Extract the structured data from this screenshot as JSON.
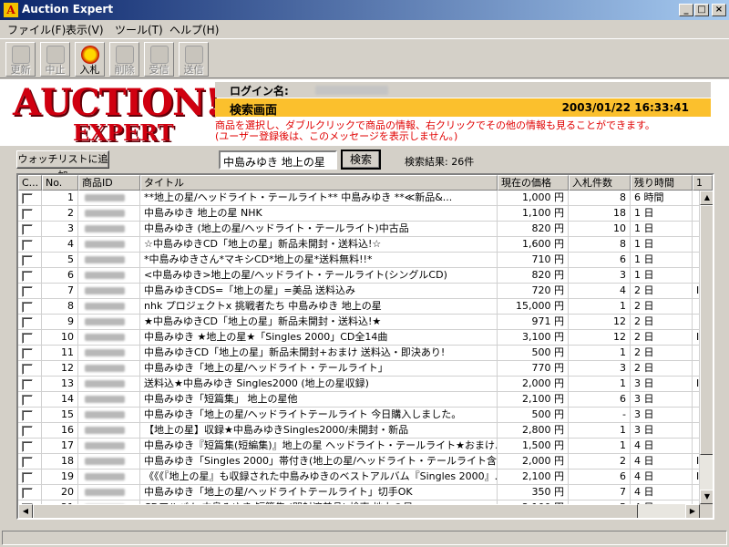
{
  "window": {
    "title": "Auction Expert",
    "app_icon_letter": "A",
    "minimize_glyph": "_",
    "maximize_glyph": "□",
    "close_glyph": "×"
  },
  "menu": [
    {
      "label": "ファイル(F)"
    },
    {
      "label": "表示(V)"
    },
    {
      "label": "ツール(T)"
    },
    {
      "label": "ヘルプ(H)"
    }
  ],
  "toolbar": [
    {
      "label": "更新",
      "icon": "refresh-icon",
      "state": "disabled"
    },
    {
      "label": "中止",
      "icon": "stop-icon",
      "state": "disabled"
    },
    {
      "label": "入札",
      "icon": "bid-coin-icon",
      "state": "active"
    },
    {
      "label": "削除",
      "icon": "delete-icon",
      "state": "disabled"
    },
    {
      "label": "受信",
      "icon": "receive-icon",
      "state": "disabled"
    },
    {
      "label": "送信",
      "icon": "send-icon",
      "state": "disabled"
    }
  ],
  "logo": {
    "line1": "AUCTION!",
    "line2": "EXPERT",
    "color": "#d00010"
  },
  "header": {
    "login_label": "ログイン名:",
    "screen_name": "検索画面",
    "datetime": "2003/01/22 16:33:41",
    "notice_line1": "商品を選択し、ダブルクリックで商品の情報、右クリックでその他の情報も見ることができます。",
    "notice_line2": "(ユーザー登録後は、このメッセージを表示しません。)",
    "screen_bar_color": "#fbc02d",
    "notice_color": "#e00000"
  },
  "search": {
    "watchlist_button": "ウォッチリストに追加",
    "query": "中島みゆき 地上の星",
    "search_button": "検索",
    "result_text": "検索結果: 26件"
  },
  "table": {
    "columns": [
      "C...",
      "No.",
      "商品ID",
      "タイトル",
      "現在の価格",
      "入札件数",
      "残り時間",
      "1"
    ],
    "rows": [
      {
        "no": "1",
        "title": "**地上の星/ヘッドライト・テールライト** 中島みゆき **≪新品&...",
        "price": "1,000 円",
        "bids": "8",
        "time": "6 時間",
        "extra": ""
      },
      {
        "no": "2",
        "title": "中島みゆき 地上の星 NHK",
        "price": "1,100 円",
        "bids": "18",
        "time": "1 日",
        "extra": ""
      },
      {
        "no": "3",
        "title": "中島みゆき (地上の星/ヘッドライト・テールライト)中古品",
        "price": "820 円",
        "bids": "10",
        "time": "1 日",
        "extra": ""
      },
      {
        "no": "4",
        "title": "☆中島みゆきCD「地上の星」新品未開封・送料込!☆",
        "price": "1,600 円",
        "bids": "8",
        "time": "1 日",
        "extra": ""
      },
      {
        "no": "5",
        "title": "*中島みゆきさん*マキシCD*地上の星*送料無料!!*",
        "price": "710 円",
        "bids": "6",
        "time": "1 日",
        "extra": ""
      },
      {
        "no": "6",
        "title": "<中島みゆき>地上の星/ヘッドライト・テールライト(シングルCD)",
        "price": "820 円",
        "bids": "3",
        "time": "1 日",
        "extra": ""
      },
      {
        "no": "7",
        "title": "中島みゆきCDS=「地上の星」=美品 送料込み",
        "price": "720 円",
        "bids": "4",
        "time": "2 日",
        "extra": "I"
      },
      {
        "no": "8",
        "title": "nhk プロジェクトx 挑戦者たち 中島みゆき 地上の星",
        "price": "15,000 円",
        "bids": "1",
        "time": "2 日",
        "extra": ""
      },
      {
        "no": "9",
        "title": "★中島みゆきCD「地上の星」新品未開封・送料込!★",
        "price": "971 円",
        "bids": "12",
        "time": "2 日",
        "extra": ""
      },
      {
        "no": "10",
        "title": "中島みゆき ★地上の星★「Singles 2000」CD全14曲",
        "price": "3,100 円",
        "bids": "12",
        "time": "2 日",
        "extra": "I"
      },
      {
        "no": "11",
        "title": "中島みゆきCD「地上の星」新品未開封+おまけ 送料込・即決あり!",
        "price": "500 円",
        "bids": "1",
        "time": "2 日",
        "extra": ""
      },
      {
        "no": "12",
        "title": "中島みゆき「地上の星/ヘッドライト・テールライト」",
        "price": "770 円",
        "bids": "3",
        "time": "2 日",
        "extra": ""
      },
      {
        "no": "13",
        "title": "送料込★中島みゆき Singles2000 (地上の星収録)",
        "price": "2,000 円",
        "bids": "1",
        "time": "3 日",
        "extra": "I"
      },
      {
        "no": "14",
        "title": "中島みゆき「短篇集」 地上の星他",
        "price": "2,100 円",
        "bids": "6",
        "time": "3 日",
        "extra": ""
      },
      {
        "no": "15",
        "title": "中島みゆき「地上の星/ヘッドライトテールライト 今日購入しました。",
        "price": "500 円",
        "bids": "-",
        "time": "3 日",
        "extra": ""
      },
      {
        "no": "16",
        "title": "【地上の星】収録★中島みゆきSingles2000/未開封・新品",
        "price": "2,800 円",
        "bids": "1",
        "time": "3 日",
        "extra": ""
      },
      {
        "no": "17",
        "title": "中島みゆき『短篇集(短編集)』地上の星 ヘッドライト・テールライト★おまけ...",
        "price": "1,500 円",
        "bids": "1",
        "time": "4 日",
        "extra": ""
      },
      {
        "no": "18",
        "title": "中島みゆき「Singles 2000」帯付き(地上の星/ヘッドライト・テールライト含...",
        "price": "2,000 円",
        "bids": "2",
        "time": "4 日",
        "extra": "I"
      },
      {
        "no": "19",
        "title": "《《《『地上の星』も収録された中島みゆきのベストアルバム『Singles 2000』...",
        "price": "2,100 円",
        "bids": "6",
        "time": "4 日",
        "extra": "I"
      },
      {
        "no": "20",
        "title": "中島みゆき「地上の星/ヘッドライトテールライト」切手OK",
        "price": "350 円",
        "bids": "7",
        "time": "4 日",
        "extra": ""
      },
      {
        "no": "21",
        "title": "CDアルバム 中島みゆき 短篇集 (開封済美品) 検索.地上の星",
        "price": "2,100 円",
        "bids": "5",
        "time": "4 日",
        "extra": ""
      }
    ]
  }
}
